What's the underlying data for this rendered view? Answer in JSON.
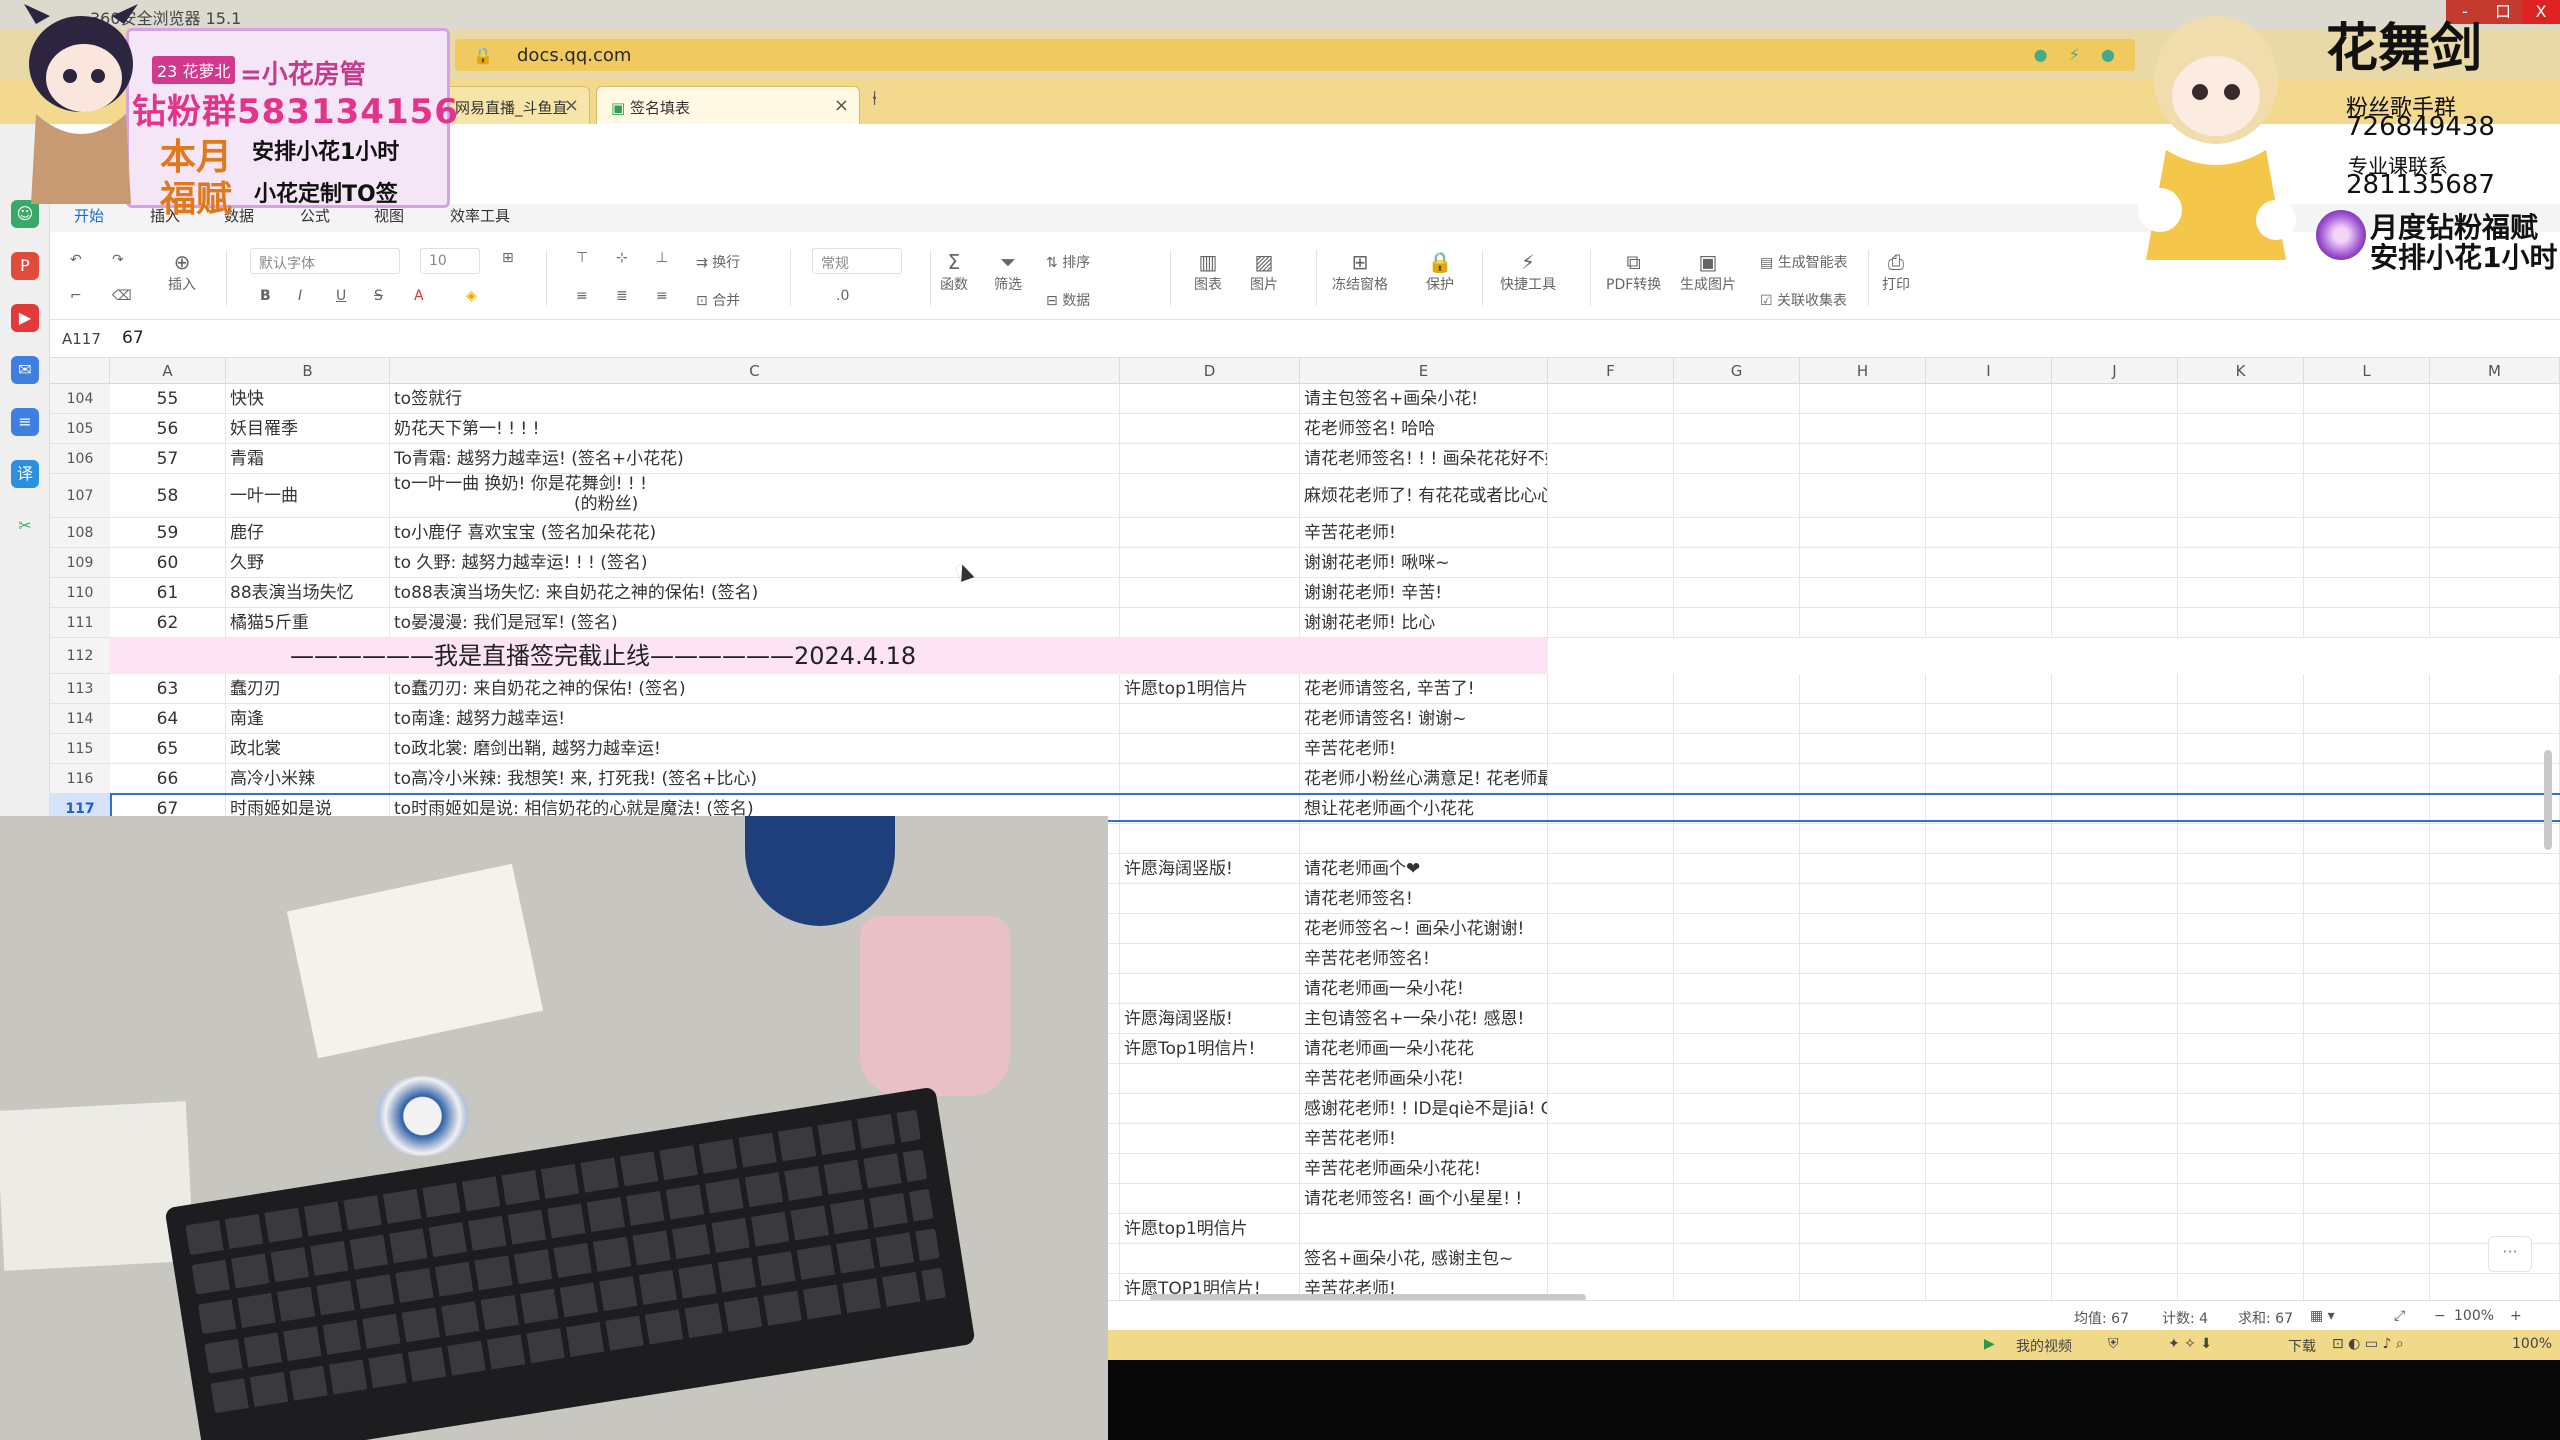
{
  "browser": {
    "title": "360安全浏览器 15.1",
    "url": "docs.qq.com",
    "tabs": [
      {
        "label": "网易直播_斗鱼直",
        "active": false
      },
      {
        "label": "签名填表",
        "active": true
      }
    ],
    "window_buttons": [
      "-",
      "口",
      "X"
    ]
  },
  "doc": {
    "menu": [
      "开始",
      "插入",
      "数据",
      "公式",
      "视图",
      "效率工具"
    ],
    "toolbar": {
      "insert": "插入",
      "font": "默认字体",
      "size": "10",
      "wrap": "换行",
      "merge": "合并",
      "format": "常规",
      "decimal": ".0",
      "function": "函数",
      "filter": "筛选",
      "sort": "排序",
      "data": "数据",
      "chart": "图表",
      "image": "图片",
      "freeze": "冻结窗格",
      "protect": "保护",
      "quick_tools": "快捷工具",
      "pdf": "PDF转换",
      "gen_image": "生成图片",
      "smart_form": "生成智能表",
      "collect_form": "关联收集表",
      "print": "打印"
    },
    "cell_ref": "A117",
    "formula_value": "67"
  },
  "grid": {
    "columns": [
      "A",
      "B",
      "C",
      "D",
      "E",
      "F",
      "G",
      "H",
      "I",
      "J",
      "K",
      "L",
      "M"
    ],
    "rows": [
      {
        "n": "104",
        "a": "55",
        "b": "快快",
        "c": "to签就行",
        "d": "",
        "e": "请主包签名+画朵小花!"
      },
      {
        "n": "105",
        "a": "56",
        "b": "妖目罹季",
        "c": "奶花天下第一! ! ! !",
        "d": "",
        "e": "花老师签名! 哈哈"
      },
      {
        "n": "106",
        "a": "57",
        "b": "青霜",
        "c": "To青霜: 越努力越幸运! (签名+小花花)",
        "d": "",
        "e": "请花老师签名! ! ! 画朵花花好不好! ! !"
      },
      {
        "n": "107",
        "a": "58",
        "b": "一叶一曲",
        "c": "to一叶一曲 换奶! 你是花舞剑! ! !",
        "c2": "(的粉丝)",
        "d": "",
        "e": "麻烦花老师了! 有花花或者比心心小图案好不好"
      },
      {
        "n": "108",
        "a": "59",
        "b": "鹿仔",
        "c": "to小鹿仔  喜欢宝宝 (签名加朵花花)",
        "d": "",
        "e": "辛苦花老师!"
      },
      {
        "n": "109",
        "a": "60",
        "b": "久野",
        "c": "to 久野: 越努力越幸运! ! ! (签名)",
        "d": "",
        "e": "谢谢花老师! 啾咪~"
      },
      {
        "n": "110",
        "a": "61",
        "b": "88表演当场失忆",
        "c": "to88表演当场失忆: 来自奶花之神的保佑! (签名)",
        "d": "",
        "e": "谢谢花老师! 辛苦!"
      },
      {
        "n": "111",
        "a": "62",
        "b": "橘猫5斤重",
        "c": "to晏漫漫: 我们是冠军! (签名)",
        "d": "",
        "e": "谢谢花老师! 比心"
      },
      {
        "n": "112",
        "banner": "——————我是直播签完截止线——————2024.4.18"
      },
      {
        "n": "113",
        "a": "63",
        "b": "蠢刃刃",
        "c": "to蠢刃刃: 来自奶花之神的保佑! (签名)",
        "d": "许愿top1明信片",
        "e": "花老师请签名, 辛苦了!"
      },
      {
        "n": "114",
        "a": "64",
        "b": "南逢",
        "c": "to南逢: 越努力越幸运!",
        "d": "",
        "e": "花老师请签名! 谢谢~"
      },
      {
        "n": "115",
        "a": "65",
        "b": "政北裳",
        "c": "to政北裳: 磨剑出鞘, 越努力越幸运!",
        "d": "",
        "e": "辛苦花老师!"
      },
      {
        "n": "116",
        "a": "66",
        "b": "高冷小米辣",
        "c": "to高冷小米辣: 我想笑! 来, 打死我! (签名+比心)",
        "d": "",
        "e": "花老师小粉丝心满意足! 花老师最棒! !"
      },
      {
        "n": "117",
        "a": "67",
        "b": "时雨姬如是说",
        "c": "to时雨姬如是说: 相信奶花的心就是魔法! (签名)",
        "d": "",
        "e": "想让花老师画个小花花",
        "selected": true
      },
      {
        "n": "",
        "d": "",
        "e": ""
      },
      {
        "n": "",
        "d": "许愿海阔竖版!",
        "e": "请花老师画个❤"
      },
      {
        "n": "",
        "d": "",
        "e": "请花老师签名!"
      },
      {
        "n": "",
        "d": "",
        "e": "花老师签名~! 画朵小花谢谢!"
      },
      {
        "n": "",
        "d": "",
        "e": "辛苦花老师签名!"
      },
      {
        "n": "",
        "d": "",
        "e": "请花老师画一朵小花!"
      },
      {
        "n": "",
        "d": "许愿海阔竖版!",
        "e": "主包请签名+一朵小花! 感恩!"
      },
      {
        "n": "",
        "d": "许愿Top1明信片!",
        "e": "请花老师画一朵小花花"
      },
      {
        "n": "",
        "d": "",
        "e": "辛苦花老师画朵小花!"
      },
      {
        "n": "",
        "d": "",
        "e": "感谢花老师! ! ID是qiè不是jiā! QAQ"
      },
      {
        "n": "",
        "d": "",
        "e": "辛苦花老师!"
      },
      {
        "n": "",
        "d": "",
        "e": "辛苦花老师画朵小花花!"
      },
      {
        "n": "",
        "d": "",
        "e": "请花老师签名! 画个小星星! !"
      },
      {
        "n": "",
        "d": "许愿top1明信片",
        "e": ""
      },
      {
        "n": "",
        "d": "",
        "e": "签名+画朵小花, 感谢主包~"
      },
      {
        "n": "",
        "d": "许愿TOP1明信片!",
        "e": "辛苦花老师!"
      }
    ]
  },
  "status": {
    "avg": "均值: 67",
    "count": "计数: 4",
    "sum": "求和: 67",
    "zoom": "100%",
    "browser_video": "我的视频",
    "browser_download": "下载",
    "browser_zoom": "100%"
  },
  "overlay_left": {
    "tag": "23 花萝北",
    "line1": "=小花房管",
    "line2": "钻粉群583134156",
    "line3a": "本月",
    "line3b": "安排小花1小时",
    "line4a": "福赋",
    "line4b": "小花定制TO签"
  },
  "overlay_right": {
    "name": "花舞剑",
    "l1": "粉丝歌手群",
    "l2": "726849438",
    "l3": "专业课联系",
    "l4": "281135687",
    "l5": "月度钻粉福赋",
    "l6": "安排小花1小时"
  }
}
